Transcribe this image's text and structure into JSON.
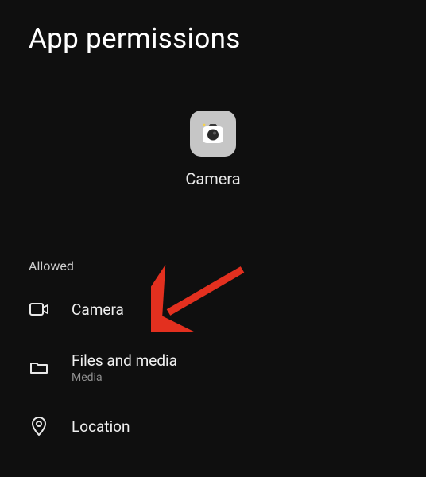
{
  "header": {
    "title": "App permissions"
  },
  "app": {
    "name": "Camera"
  },
  "sections": {
    "allowed": {
      "label": "Allowed",
      "items": [
        {
          "label": "Camera",
          "sub": ""
        },
        {
          "label": "Files and media",
          "sub": "Media"
        },
        {
          "label": "Location",
          "sub": ""
        }
      ]
    }
  }
}
